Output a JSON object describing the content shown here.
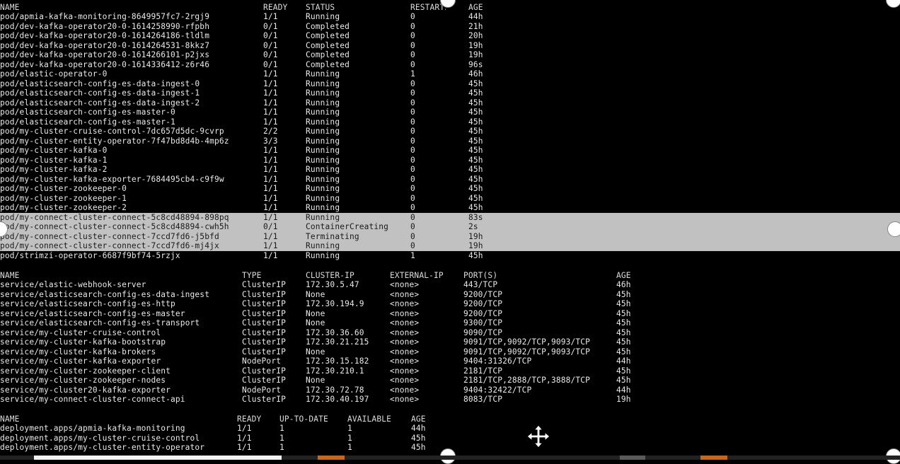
{
  "pods": {
    "header": [
      "NAME",
      "READY",
      "STATUS",
      "RESTARTS",
      "AGE"
    ],
    "rows": [
      [
        "pod/apmia-kafka-monitoring-8649957fc7-2rgj9",
        "1/1",
        "Running",
        "0",
        "44h"
      ],
      [
        "pod/dev-kafka-operator20-0-1614258990-rfpbh",
        "0/1",
        "Completed",
        "0",
        "21h"
      ],
      [
        "pod/dev-kafka-operator20-0-1614264186-tldlm",
        "0/1",
        "Completed",
        "0",
        "20h"
      ],
      [
        "pod/dev-kafka-operator20-0-1614264531-8kkz7",
        "0/1",
        "Completed",
        "0",
        "19h"
      ],
      [
        "pod/dev-kafka-operator20-0-1614266101-p2jxs",
        "0/1",
        "Completed",
        "0",
        "19h"
      ],
      [
        "pod/dev-kafka-operator20-0-1614336412-z6r46",
        "0/1",
        "Completed",
        "0",
        "96s"
      ],
      [
        "pod/elastic-operator-0",
        "1/1",
        "Running",
        "1",
        "46h"
      ],
      [
        "pod/elasticsearch-config-es-data-ingest-0",
        "1/1",
        "Running",
        "0",
        "45h"
      ],
      [
        "pod/elasticsearch-config-es-data-ingest-1",
        "1/1",
        "Running",
        "0",
        "45h"
      ],
      [
        "pod/elasticsearch-config-es-data-ingest-2",
        "1/1",
        "Running",
        "0",
        "45h"
      ],
      [
        "pod/elasticsearch-config-es-master-0",
        "1/1",
        "Running",
        "0",
        "45h"
      ],
      [
        "pod/elasticsearch-config-es-master-1",
        "1/1",
        "Running",
        "0",
        "45h"
      ],
      [
        "pod/my-cluster-cruise-control-7dc657d5dc-9cvrp",
        "2/2",
        "Running",
        "0",
        "45h"
      ],
      [
        "pod/my-cluster-entity-operator-7f47bd8d4b-4mp6z",
        "3/3",
        "Running",
        "0",
        "45h"
      ],
      [
        "pod/my-cluster-kafka-0",
        "1/1",
        "Running",
        "0",
        "45h"
      ],
      [
        "pod/my-cluster-kafka-1",
        "1/1",
        "Running",
        "0",
        "45h"
      ],
      [
        "pod/my-cluster-kafka-2",
        "1/1",
        "Running",
        "0",
        "45h"
      ],
      [
        "pod/my-cluster-kafka-exporter-7684495cb4-c9f9w",
        "1/1",
        "Running",
        "0",
        "45h"
      ],
      [
        "pod/my-cluster-zookeeper-0",
        "1/1",
        "Running",
        "0",
        "45h"
      ],
      [
        "pod/my-cluster-zookeeper-1",
        "1/1",
        "Running",
        "0",
        "45h"
      ],
      [
        "pod/my-cluster-zookeeper-2",
        "1/1",
        "Running",
        "0",
        "45h"
      ],
      [
        "pod/my-connect-cluster-connect-5c8cd48894-898pq",
        "1/1",
        "Running",
        "0",
        "83s"
      ],
      [
        "pod/my-connect-cluster-connect-5c8cd48894-cwh5h",
        "0/1",
        "ContainerCreating",
        "0",
        "2s"
      ],
      [
        "pod/my-connect-cluster-connect-7ccd7fd6-j5bfd",
        "1/1",
        "Terminating",
        "0",
        "19h"
      ],
      [
        "pod/my-connect-cluster-connect-7ccd7fd6-mj4jx",
        "1/1",
        "Running",
        "0",
        "19h"
      ],
      [
        "pod/strimzi-operator-6687f9bf74-5rzjx",
        "1/1",
        "Running",
        "1",
        "45h"
      ]
    ]
  },
  "services": {
    "header": [
      "NAME",
      "TYPE",
      "CLUSTER-IP",
      "EXTERNAL-IP",
      "PORT(S)",
      "AGE"
    ],
    "rows": [
      [
        "service/elastic-webhook-server",
        "ClusterIP",
        "172.30.5.47",
        "<none>",
        "443/TCP",
        "46h"
      ],
      [
        "service/elasticsearch-config-es-data-ingest",
        "ClusterIP",
        "None",
        "<none>",
        "9200/TCP",
        "45h"
      ],
      [
        "service/elasticsearch-config-es-http",
        "ClusterIP",
        "172.30.194.9",
        "<none>",
        "9200/TCP",
        "45h"
      ],
      [
        "service/elasticsearch-config-es-master",
        "ClusterIP",
        "None",
        "<none>",
        "9200/TCP",
        "45h"
      ],
      [
        "service/elasticsearch-config-es-transport",
        "ClusterIP",
        "None",
        "<none>",
        "9300/TCP",
        "45h"
      ],
      [
        "service/my-cluster-cruise-control",
        "ClusterIP",
        "172.30.36.60",
        "<none>",
        "9090/TCP",
        "45h"
      ],
      [
        "service/my-cluster-kafka-bootstrap",
        "ClusterIP",
        "172.30.21.215",
        "<none>",
        "9091/TCP,9092/TCP,9093/TCP",
        "45h"
      ],
      [
        "service/my-cluster-kafka-brokers",
        "ClusterIP",
        "None",
        "<none>",
        "9091/TCP,9092/TCP,9093/TCP",
        "45h"
      ],
      [
        "service/my-cluster-kafka-exporter",
        "NodePort",
        "172.30.15.182",
        "<none>",
        "9404:31326/TCP",
        "44h"
      ],
      [
        "service/my-cluster-zookeeper-client",
        "ClusterIP",
        "172.30.210.1",
        "<none>",
        "2181/TCP",
        "45h"
      ],
      [
        "service/my-cluster-zookeeper-nodes",
        "ClusterIP",
        "None",
        "<none>",
        "2181/TCP,2888/TCP,3888/TCP",
        "45h"
      ],
      [
        "service/my-cluster20-kafka-exporter",
        "NodePort",
        "172.30.72.78",
        "<none>",
        "9404:32422/TCP",
        "44h"
      ],
      [
        "service/my-connect-cluster-connect-api",
        "ClusterIP",
        "172.30.40.197",
        "<none>",
        "8083/TCP",
        "19h"
      ]
    ]
  },
  "deployments": {
    "header": [
      "NAME",
      "READY",
      "UP-TO-DATE",
      "AVAILABLE",
      "AGE"
    ],
    "rows": [
      [
        "deployment.apps/apmia-kafka-monitoring",
        "1/1",
        "1",
        "1",
        "44h"
      ],
      [
        "deployment.apps/my-cluster-cruise-control",
        "1/1",
        "1",
        "1",
        "45h"
      ],
      [
        "deployment.apps/my-cluster-entity-operator",
        "1/1",
        "1",
        "1",
        "45h"
      ]
    ]
  },
  "highlighted_pod_rows": [
    21,
    22,
    23,
    24
  ],
  "icons": {
    "move": "move-arrows-icon",
    "handle": "resize-handle-icon"
  },
  "colors": {
    "background": "#000000",
    "text": "#e9e9e9",
    "selection": "#c1c1c1",
    "accent_orange": "#c8661e"
  }
}
